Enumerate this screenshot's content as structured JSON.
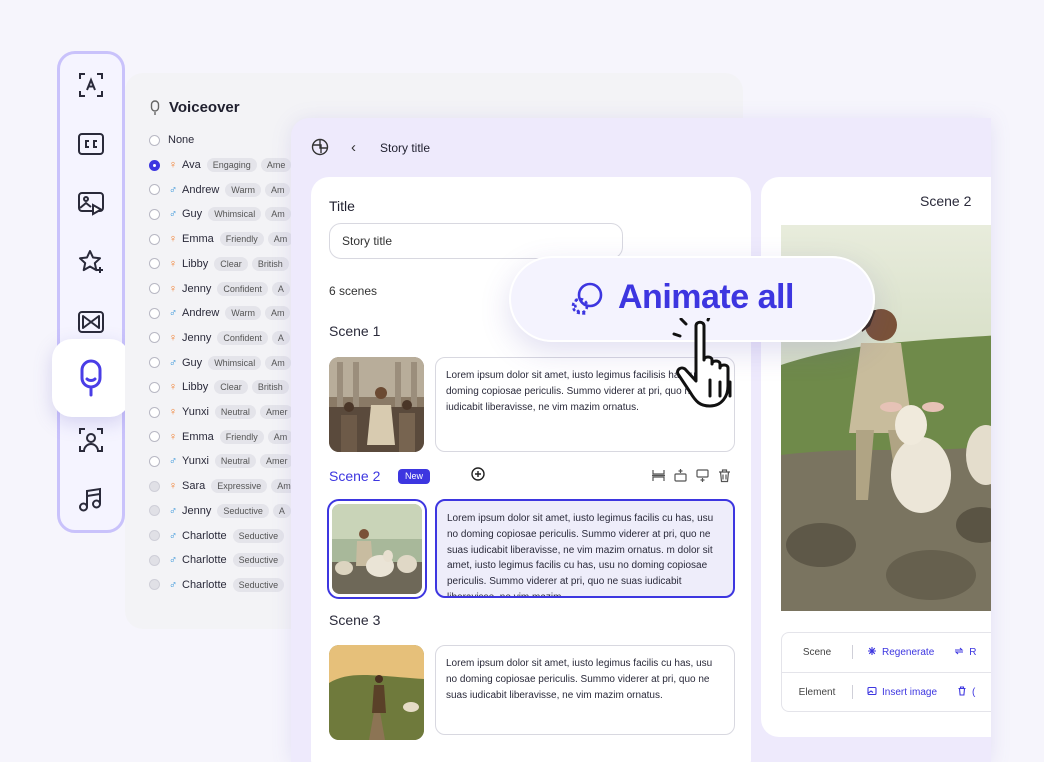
{
  "toolbar": {
    "tools": [
      {
        "icon": "text-frame-icon"
      },
      {
        "icon": "closed-captions-icon"
      },
      {
        "icon": "image-video-icon"
      },
      {
        "icon": "sparkle-star-icon"
      },
      {
        "icon": "transition-icon"
      },
      {
        "icon": "microphone-icon",
        "active": true
      },
      {
        "icon": "avatar-icon"
      },
      {
        "icon": "music-icon"
      }
    ]
  },
  "voiceover": {
    "title": "Voiceover",
    "none_label": "None",
    "voices": [
      {
        "gender": "f",
        "name": "Ava",
        "tag": "Engaging",
        "accent": "Ame",
        "selected": true
      },
      {
        "gender": "m",
        "name": "Andrew",
        "tag": "Warm",
        "accent": "Am"
      },
      {
        "gender": "m",
        "name": "Guy",
        "tag": "Whimsical",
        "accent": "Am"
      },
      {
        "gender": "f",
        "name": "Emma",
        "tag": "Friendly",
        "accent": "Am"
      },
      {
        "gender": "f",
        "name": "Libby",
        "tag": "Clear",
        "accent": "British"
      },
      {
        "gender": "f",
        "name": "Jenny",
        "tag": "Confident",
        "accent": "A"
      },
      {
        "gender": "m",
        "name": "Andrew",
        "tag": "Warm",
        "accent": "Am"
      },
      {
        "gender": "f",
        "name": "Jenny",
        "tag": "Confident",
        "accent": "A"
      },
      {
        "gender": "m",
        "name": "Guy",
        "tag": "Whimsical",
        "accent": "Am"
      },
      {
        "gender": "f",
        "name": "Libby",
        "tag": "Clear",
        "accent": "British"
      },
      {
        "gender": "f",
        "name": "Yunxi",
        "tag": "Neutral",
        "accent": "Amer"
      },
      {
        "gender": "f",
        "name": "Emma",
        "tag": "Friendly",
        "accent": "Am"
      },
      {
        "gender": "m",
        "name": "Yunxi",
        "tag": "Neutral",
        "accent": "Amer"
      },
      {
        "gender": "f",
        "name": "Sara",
        "tag": "Expressive",
        "accent": "Am",
        "disabled": true
      },
      {
        "gender": "m",
        "name": "Jenny",
        "tag": "Seductive",
        "accent": "A",
        "disabled": true
      },
      {
        "gender": "m",
        "name": "Charlotte",
        "tag": "Seductive",
        "accent": "",
        "disabled": true
      },
      {
        "gender": "m",
        "name": "Charlotte",
        "tag": "Seductive",
        "accent": "",
        "disabled": true
      },
      {
        "gender": "m",
        "name": "Charlotte",
        "tag": "Seductive",
        "accent": "",
        "disabled": true
      }
    ]
  },
  "editor": {
    "header_title": "Story title",
    "title_label": "Title",
    "title_value": "Story title",
    "scenes_count": "6 scenes",
    "badge_new": "New",
    "scenes": [
      {
        "name": "Scene 1",
        "text": "Lorem ipsum dolor sit amet, iusto legimus facilisis has, usu no doming copiosae periculis. Summo viderer at pri, quo ne suas iudicabit liberavisse, ne vim mazim ornatus."
      },
      {
        "name": "Scene 2",
        "text": "Lorem ipsum dolor sit amet, iusto legimus facilis cu has, usu no doming copiosae periculis. Summo viderer at pri, quo ne suas iudicabit liberavisse, ne vim mazim ornatus.  m dolor sit amet, iusto legimus facilis cu has, usu no doming copiosae periculis. Summo viderer at pri, quo ne suas iudicabit liberavisse, ne vim mazim"
      },
      {
        "name": "Scene 3",
        "text": "Lorem ipsum dolor sit amet, iusto legimus facilis cu has, usu no doming copiosae periculis. Summo viderer at pri, quo ne suas iudicabit liberavisse, ne vim mazim ornatus."
      }
    ],
    "preview": {
      "title": "Scene 2",
      "rows": [
        {
          "label": "Scene",
          "action1": "Regenerate",
          "action2": "R"
        },
        {
          "label": "Element",
          "action1": "Insert image",
          "action2": "("
        }
      ]
    }
  },
  "animate": {
    "label": "Animate all"
  },
  "colors": {
    "accent": "#3d36e0",
    "toolbar_border": "#c9c2fb",
    "female": "#f07a28",
    "male": "#2b8fd8"
  }
}
